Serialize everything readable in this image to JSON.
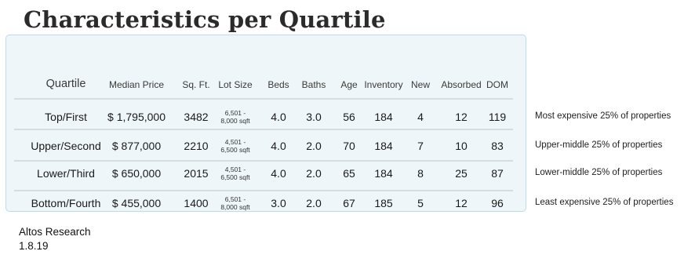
{
  "title": "Characteristics per Quartile",
  "headers": [
    "Quartile",
    "Median Price",
    "Sq. Ft.",
    "Lot Size",
    "Beds",
    "Baths",
    "Age",
    "Inventory",
    "New",
    "Absorbed",
    "DOM"
  ],
  "rows": [
    {
      "quartile": "Top/First",
      "price": "$ 1,795,000",
      "sqft": "3482",
      "lot_line1": "6,501 -",
      "lot_line2": "8,000 sqft",
      "beds": "4.0",
      "baths": "3.0",
      "age": "56",
      "inventory": "184",
      "new": "4",
      "absorbed": "12",
      "dom": "119",
      "note": "Most expensive 25% of properties"
    },
    {
      "quartile": "Upper/Second",
      "price": "$ 877,000",
      "sqft": "2210",
      "lot_line1": "4,501 -",
      "lot_line2": "6,500 sqft",
      "beds": "4.0",
      "baths": "2.0",
      "age": "70",
      "inventory": "184",
      "new": "7",
      "absorbed": "10",
      "dom": "83",
      "note": "Upper-middle 25% of properties"
    },
    {
      "quartile": "Lower/Third",
      "price": "$ 650,000",
      "sqft": "2015",
      "lot_line1": "4,501 -",
      "lot_line2": "6,500 sqft",
      "beds": "4.0",
      "baths": "2.0",
      "age": "65",
      "inventory": "184",
      "new": "8",
      "absorbed": "25",
      "dom": "87",
      "note": "Lower-middle 25% of properties"
    },
    {
      "quartile": "Bottom/Fourth",
      "price": "$ 455,000",
      "sqft": "1400",
      "lot_line1": "6,501 -",
      "lot_line2": "8,000 sqft",
      "beds": "3.0",
      "baths": "2.0",
      "age": "67",
      "inventory": "185",
      "new": "5",
      "absorbed": "12",
      "dom": "96",
      "note": "Least expensive 25% of properties"
    }
  ],
  "source": {
    "name": "Altos Research",
    "date": "1.8.19"
  }
}
